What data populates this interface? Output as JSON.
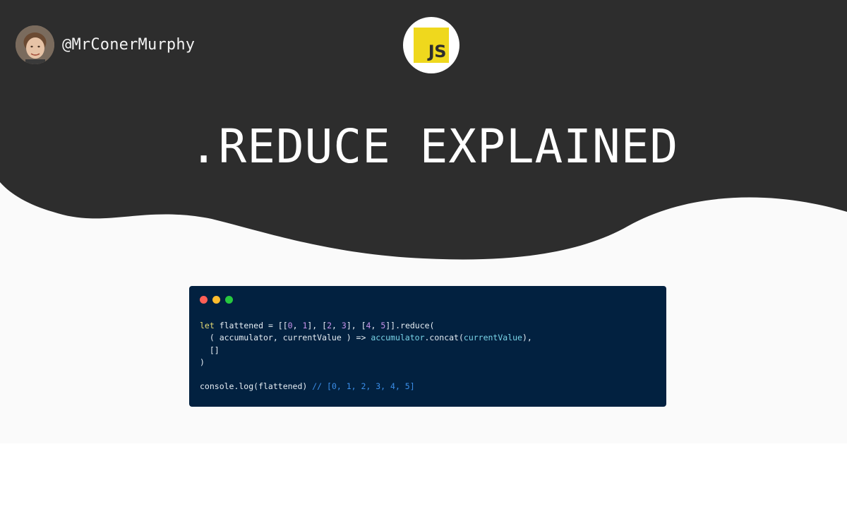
{
  "header": {
    "author_handle": "@MrConerMurphy",
    "badge_text": "JS",
    "title": ".REDUCE EXPLAINED"
  },
  "code": {
    "lines": [
      [
        {
          "t": "let",
          "c": "kw"
        },
        {
          "t": " flattened = [["
        },
        {
          "t": "0",
          "c": "num"
        },
        {
          "t": ", "
        },
        {
          "t": "1",
          "c": "num"
        },
        {
          "t": "], ["
        },
        {
          "t": "2",
          "c": "num"
        },
        {
          "t": ", "
        },
        {
          "t": "3",
          "c": "num"
        },
        {
          "t": "], ["
        },
        {
          "t": "4",
          "c": "num"
        },
        {
          "t": ", "
        },
        {
          "t": "5",
          "c": "num"
        },
        {
          "t": "]].reduce("
        }
      ],
      [
        {
          "t": "  ( accumulator, currentValue ) => "
        },
        {
          "t": "accumulator",
          "c": "fn"
        },
        {
          "t": ".concat("
        },
        {
          "t": "currentValue",
          "c": "fn"
        },
        {
          "t": "),"
        }
      ],
      [
        {
          "t": "  []"
        }
      ],
      [
        {
          "t": ")"
        }
      ],
      [
        {
          "t": ""
        }
      ],
      [
        {
          "t": "console.log(flattened) "
        },
        {
          "t": "// [0, 1, 2, 3, 4, 5]",
          "c": "cm"
        }
      ]
    ]
  },
  "colors": {
    "dark_header": "#2d2d2d",
    "light_background": "#fafafa",
    "code_background": "#022140",
    "js_yellow": "#efd81d"
  },
  "icons": {
    "window_controls": [
      "red-dot-icon",
      "yellow-dot-icon",
      "green-dot-icon"
    ],
    "badge": "javascript-logo-icon"
  }
}
